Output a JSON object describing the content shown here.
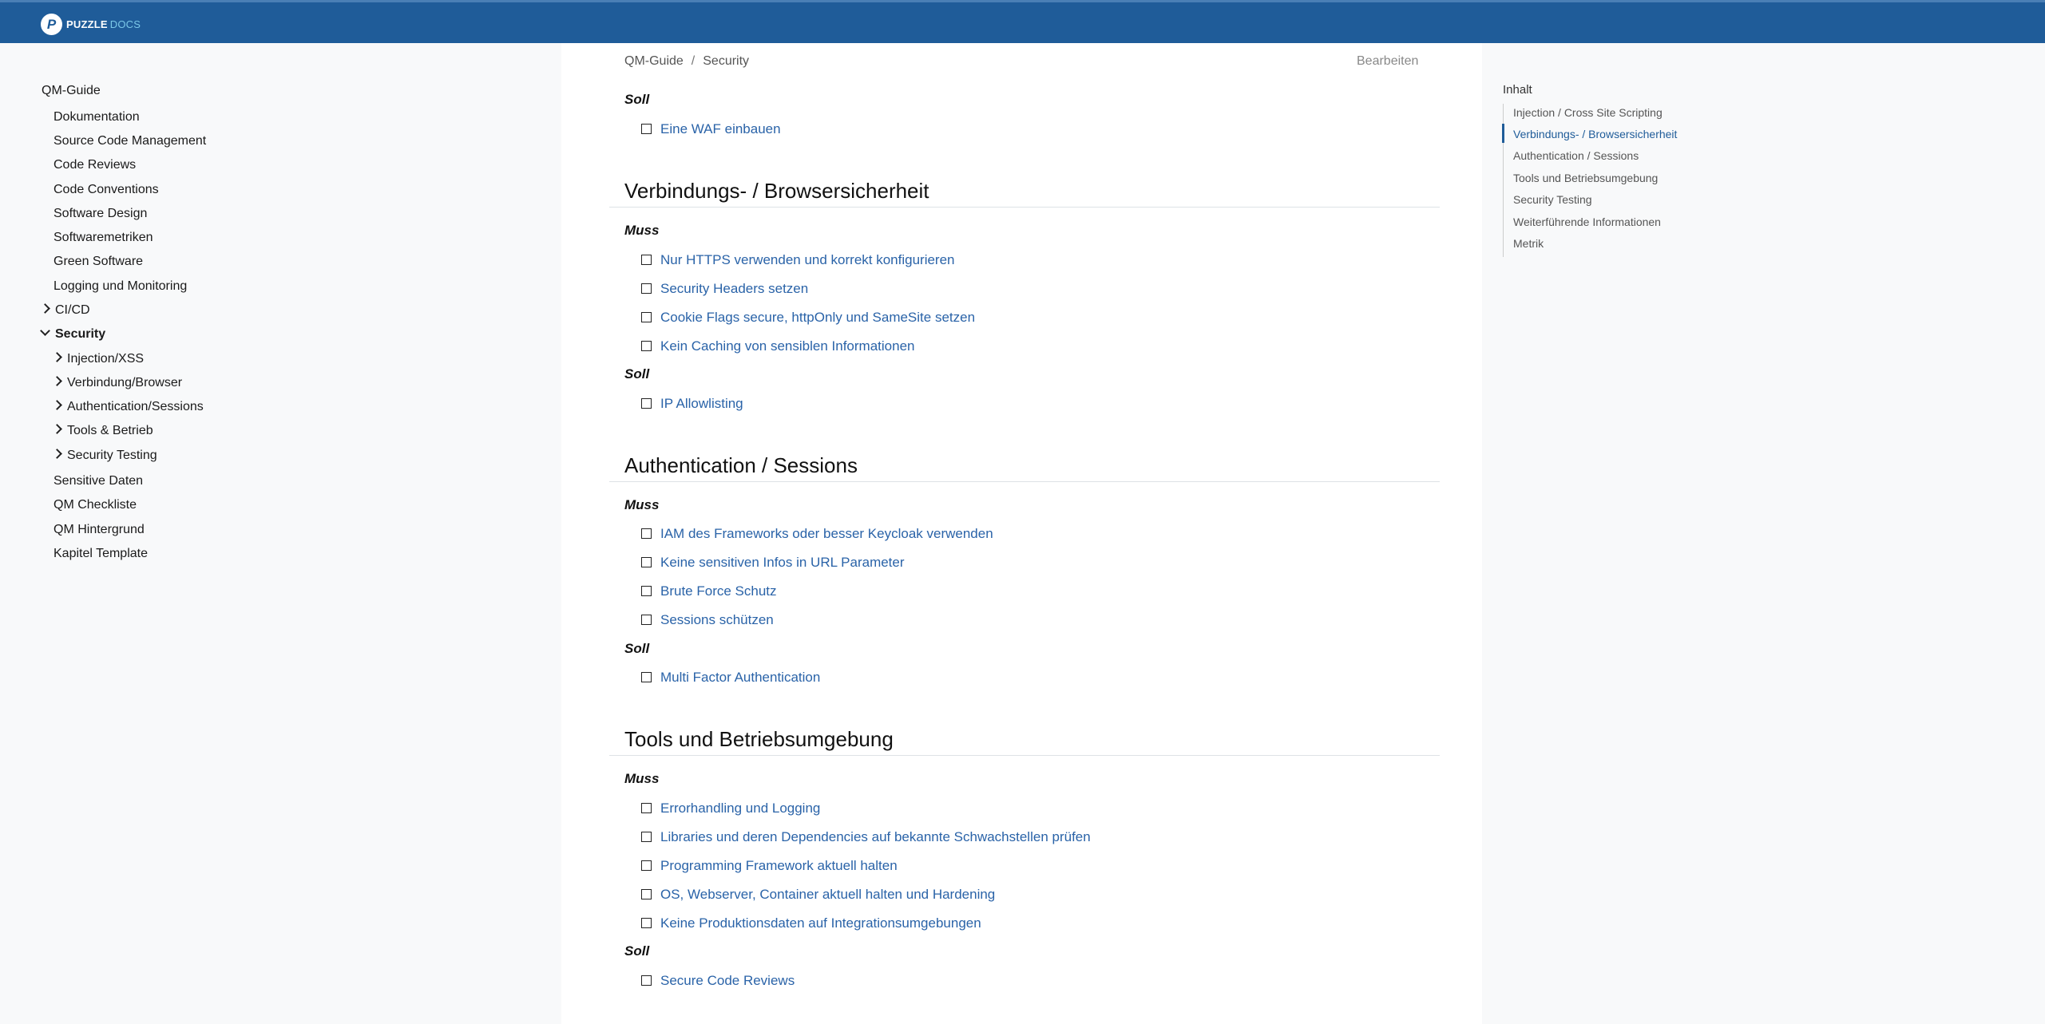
{
  "header": {
    "logo_mark": "P",
    "brand": "PUZZLE",
    "product": "DOCS"
  },
  "sidebar": {
    "items": [
      {
        "label": "QM-Guide"
      },
      {
        "label": "Dokumentation"
      },
      {
        "label": "Source Code Management"
      },
      {
        "label": "Code Reviews"
      },
      {
        "label": "Code Conventions"
      },
      {
        "label": "Software Design"
      },
      {
        "label": "Softwaremetriken"
      },
      {
        "label": "Green Software"
      },
      {
        "label": "Logging und Monitoring"
      },
      {
        "label": "CI/CD"
      },
      {
        "label": "Security"
      },
      {
        "label": "Injection/XSS"
      },
      {
        "label": "Verbindung/Browser"
      },
      {
        "label": "Authentication/Sessions"
      },
      {
        "label": "Tools & Betrieb"
      },
      {
        "label": "Security Testing"
      },
      {
        "label": "Sensitive Daten"
      },
      {
        "label": "QM Checkliste"
      },
      {
        "label": "QM Hintergrund"
      },
      {
        "label": "Kapitel Template"
      }
    ]
  },
  "breadcrumb": {
    "root": "QM-Guide",
    "separator": "/",
    "current": "Security"
  },
  "edit_label": "Bearbeiten",
  "content": {
    "soll": "Soll",
    "muss": "Muss",
    "intro_soll_items": [
      "Eine WAF einbauen"
    ],
    "sections": [
      {
        "title": "Verbindungs- / Browsersicherheit",
        "muss": [
          "Nur HTTPS verwenden und korrekt konfigurieren",
          "Security Headers setzen",
          "Cookie Flags secure, httpOnly und SameSite setzen",
          "Kein Caching von sensiblen Informationen"
        ],
        "soll": [
          "IP Allowlisting"
        ]
      },
      {
        "title": "Authentication / Sessions",
        "muss": [
          "IAM des Frameworks oder besser Keycloak verwenden",
          "Keine sensitiven Infos in URL Parameter",
          "Brute Force Schutz",
          "Sessions schützen"
        ],
        "soll": [
          "Multi Factor Authentication"
        ]
      },
      {
        "title": "Tools und Betriebsumgebung",
        "muss": [
          "Errorhandling und Logging",
          "Libraries und deren Dependencies auf bekannte Schwachstellen prüfen",
          "Programming Framework aktuell halten",
          "OS, Webserver, Container aktuell halten und Hardening",
          "Keine Produktionsdaten auf Integrationsumgebungen"
        ],
        "soll": [
          "Secure Code Reviews"
        ]
      }
    ]
  },
  "toc": {
    "title": "Inhalt",
    "items": [
      "Injection / Cross Site Scripting",
      "Verbindungs- / Browsersicherheit",
      "Authentication / Sessions",
      "Tools und Betriebsumgebung",
      "Security Testing",
      "Weiterführende Informationen",
      "Metrik"
    ]
  }
}
